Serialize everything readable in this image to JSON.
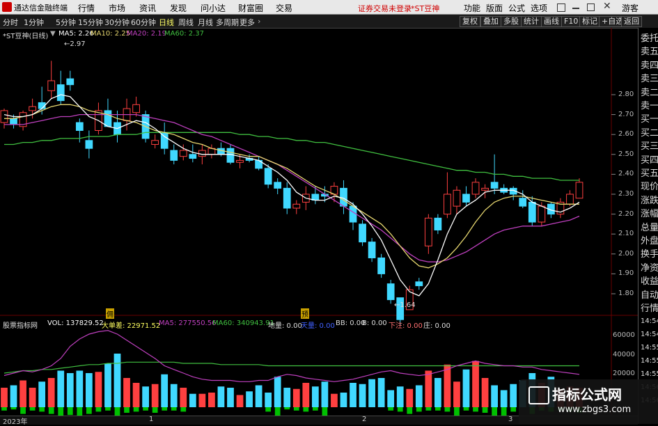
{
  "menubar": {
    "app_title": "通达信金融终端",
    "items": [
      "行情",
      "市场",
      "资讯",
      "发现",
      "问小达",
      "财富圈",
      "交易"
    ],
    "notice": "证券交易未登录",
    "stock": "*ST豆神",
    "right_items": [
      "功能",
      "版面",
      "公式",
      "选项"
    ],
    "guest": "游客"
  },
  "toolbar": {
    "periods": [
      "分时",
      "1分钟",
      "5分钟",
      "15分钟",
      "30分钟",
      "60分钟",
      "日线",
      "周线",
      "月线",
      "多周期",
      "更多"
    ],
    "active_period": "日线",
    "right_buttons": [
      "复权",
      "叠加",
      "多股",
      "统计",
      "画线",
      "F10",
      "标记",
      "+自选",
      "返回"
    ]
  },
  "price_legend": {
    "name": "*ST豆神(日线)",
    "ma5": "MA5: 2.26",
    "ma10": "MA10: 2.25",
    "ma20": "MA20: 2.19",
    "ma60": "MA60: 2.37"
  },
  "price_axis": [
    "2.80",
    "2.70",
    "2.60",
    "2.50",
    "2.40",
    "2.30",
    "2.20",
    "2.10",
    "2.00",
    "1.90",
    "1.80"
  ],
  "annotations": {
    "high": "2.97",
    "low": "1.64",
    "mark1": "佣",
    "mark2": "预"
  },
  "volume_legend": {
    "name": "股票指标网",
    "vol": "VOL: 137829.52",
    "big_diff": "大单差: 22971.52",
    "ma5": "MA5: 277550.56",
    "ma60": "MA60: 340943.91",
    "diliang": "地量: 0.00",
    "tianliang": "天量: 0.00",
    "bb": "BB: 0.00",
    "b": "B: 0.00",
    "xiazhu": "下注: 0.00",
    "zhuang": "庄: 0.00"
  },
  "volume_axis": [
    "60000",
    "40000",
    "20000"
  ],
  "time_axis": [
    "2023年",
    "1",
    "2",
    "3"
  ],
  "right_panel": {
    "labels": [
      "委托",
      "卖五",
      "卖四",
      "卖三",
      "卖二",
      "卖一",
      "买一",
      "买二",
      "买三",
      "买四",
      "买五",
      "现价",
      "涨跌",
      "涨幅",
      "总量",
      "外盘",
      "换手",
      "净资",
      "收益",
      "自动",
      "行情"
    ],
    "times": [
      "14:54",
      "14:54",
      "14:55",
      "14:55",
      "14:55",
      "14:56",
      "14:56"
    ]
  },
  "watermark": {
    "title": "指标公式网",
    "url": "www.zbgs3.com"
  },
  "colors": {
    "up": "#ff4040",
    "down": "#40d8ff",
    "ma5": "#ffffff",
    "ma10": "#e8d870",
    "ma20": "#c040c0",
    "ma60": "#40c040",
    "volume_ma5": "#c040c0",
    "volume_ma60": "#40c040",
    "negative_bar": "#00c000"
  },
  "chart_data": {
    "type": "candlestick",
    "y_range": [
      1.64,
      2.97
    ],
    "candles": [
      {
        "o": 2.66,
        "h": 2.73,
        "l": 2.63,
        "c": 2.72
      },
      {
        "o": 2.68,
        "h": 2.7,
        "l": 2.63,
        "c": 2.65
      },
      {
        "o": 2.64,
        "h": 2.72,
        "l": 2.62,
        "c": 2.71
      },
      {
        "o": 2.72,
        "h": 2.78,
        "l": 2.68,
        "c": 2.74
      },
      {
        "o": 2.76,
        "h": 2.84,
        "l": 2.7,
        "c": 2.73
      },
      {
        "o": 2.82,
        "h": 2.97,
        "l": 2.78,
        "c": 2.87
      },
      {
        "o": 2.85,
        "h": 2.92,
        "l": 2.75,
        "c": 2.77
      },
      {
        "o": 2.88,
        "h": 2.92,
        "l": 2.82,
        "c": 2.85
      },
      {
        "o": 2.66,
        "h": 2.68,
        "l": 2.56,
        "c": 2.62
      },
      {
        "o": 2.57,
        "h": 2.62,
        "l": 2.48,
        "c": 2.53
      },
      {
        "o": 2.62,
        "h": 2.76,
        "l": 2.6,
        "c": 2.72
      },
      {
        "o": 2.72,
        "h": 2.78,
        "l": 2.68,
        "c": 2.64
      },
      {
        "o": 2.66,
        "h": 2.72,
        "l": 2.56,
        "c": 2.6
      },
      {
        "o": 2.67,
        "h": 2.78,
        "l": 2.62,
        "c": 2.73
      },
      {
        "o": 2.71,
        "h": 2.79,
        "l": 2.69,
        "c": 2.75
      },
      {
        "o": 2.7,
        "h": 2.72,
        "l": 2.56,
        "c": 2.58
      },
      {
        "o": 2.55,
        "h": 2.6,
        "l": 2.53,
        "c": 2.57
      },
      {
        "o": 2.61,
        "h": 2.66,
        "l": 2.5,
        "c": 2.53
      },
      {
        "o": 2.52,
        "h": 2.55,
        "l": 2.45,
        "c": 2.47
      },
      {
        "o": 2.49,
        "h": 2.55,
        "l": 2.47,
        "c": 2.52
      },
      {
        "o": 2.5,
        "h": 2.55,
        "l": 2.46,
        "c": 2.48
      },
      {
        "o": 2.49,
        "h": 2.55,
        "l": 2.45,
        "c": 2.52
      },
      {
        "o": 2.5,
        "h": 2.55,
        "l": 2.48,
        "c": 2.53
      },
      {
        "o": 2.53,
        "h": 2.56,
        "l": 2.49,
        "c": 2.5
      },
      {
        "o": 2.53,
        "h": 2.55,
        "l": 2.45,
        "c": 2.46
      },
      {
        "o": 2.46,
        "h": 2.5,
        "l": 2.43,
        "c": 2.47
      },
      {
        "o": 2.48,
        "h": 2.5,
        "l": 2.46,
        "c": 2.47
      },
      {
        "o": 2.47,
        "h": 2.49,
        "l": 2.42,
        "c": 2.43
      },
      {
        "o": 2.43,
        "h": 2.45,
        "l": 2.33,
        "c": 2.35
      },
      {
        "o": 2.36,
        "h": 2.38,
        "l": 2.3,
        "c": 2.33
      },
      {
        "o": 2.33,
        "h": 2.36,
        "l": 2.2,
        "c": 2.23
      },
      {
        "o": 2.23,
        "h": 2.27,
        "l": 2.2,
        "c": 2.25
      },
      {
        "o": 2.26,
        "h": 2.34,
        "l": 2.22,
        "c": 2.3
      },
      {
        "o": 2.3,
        "h": 2.34,
        "l": 2.25,
        "c": 2.27
      },
      {
        "o": 2.3,
        "h": 2.34,
        "l": 2.26,
        "c": 2.29
      },
      {
        "o": 2.3,
        "h": 2.36,
        "l": 2.26,
        "c": 2.34
      },
      {
        "o": 2.33,
        "h": 2.37,
        "l": 2.2,
        "c": 2.24
      },
      {
        "o": 2.24,
        "h": 2.26,
        "l": 2.12,
        "c": 2.16
      },
      {
        "o": 2.15,
        "h": 2.17,
        "l": 2.04,
        "c": 2.06
      },
      {
        "o": 2.06,
        "h": 2.08,
        "l": 1.96,
        "c": 1.98
      },
      {
        "o": 1.98,
        "h": 2.0,
        "l": 1.88,
        "c": 1.9
      },
      {
        "o": 1.85,
        "h": 1.87,
        "l": 1.75,
        "c": 1.77
      },
      {
        "o": 1.78,
        "h": 1.78,
        "l": 1.64,
        "c": 1.67
      },
      {
        "o": 1.72,
        "h": 1.84,
        "l": 1.72,
        "c": 1.82
      },
      {
        "o": 1.86,
        "h": 1.88,
        "l": 1.82,
        "c": 1.84
      },
      {
        "o": 2.04,
        "h": 2.2,
        "l": 2.0,
        "c": 2.18
      },
      {
        "o": 2.18,
        "h": 2.2,
        "l": 2.1,
        "c": 2.12
      },
      {
        "o": 2.2,
        "h": 2.41,
        "l": 2.18,
        "c": 2.3
      },
      {
        "o": 2.24,
        "h": 2.34,
        "l": 2.2,
        "c": 2.32
      },
      {
        "o": 2.3,
        "h": 2.34,
        "l": 2.24,
        "c": 2.26
      },
      {
        "o": 2.3,
        "h": 2.38,
        "l": 2.28,
        "c": 2.36
      },
      {
        "o": 2.32,
        "h": 2.35,
        "l": 2.28,
        "c": 2.33
      },
      {
        "o": 2.36,
        "h": 2.5,
        "l": 2.3,
        "c": 2.33
      },
      {
        "o": 2.33,
        "h": 2.35,
        "l": 2.3,
        "c": 2.31
      },
      {
        "o": 2.33,
        "h": 2.34,
        "l": 2.27,
        "c": 2.3
      },
      {
        "o": 2.28,
        "h": 2.32,
        "l": 2.23,
        "c": 2.24
      },
      {
        "o": 2.26,
        "h": 2.29,
        "l": 2.14,
        "c": 2.16
      },
      {
        "o": 2.16,
        "h": 2.26,
        "l": 2.14,
        "c": 2.24
      },
      {
        "o": 2.25,
        "h": 2.26,
        "l": 2.18,
        "c": 2.2
      },
      {
        "o": 2.2,
        "h": 2.28,
        "l": 2.18,
        "c": 2.26
      },
      {
        "o": 2.25,
        "h": 2.32,
        "l": 2.24,
        "c": 2.3
      },
      {
        "o": 2.28,
        "h": 2.38,
        "l": 2.28,
        "c": 2.36
      }
    ],
    "ma5": [
      2.7,
      2.69,
      2.69,
      2.7,
      2.73,
      2.78,
      2.8,
      2.79,
      2.74,
      2.69,
      2.67,
      2.64,
      2.63,
      2.65,
      2.67,
      2.66,
      2.63,
      2.59,
      2.56,
      2.53,
      2.51,
      2.5,
      2.5,
      2.5,
      2.5,
      2.49,
      2.48,
      2.47,
      2.44,
      2.41,
      2.37,
      2.31,
      2.28,
      2.27,
      2.27,
      2.29,
      2.28,
      2.25,
      2.2,
      2.14,
      2.07,
      1.97,
      1.87,
      1.81,
      1.79,
      1.85,
      1.97,
      2.1,
      2.2,
      2.24,
      2.27,
      2.31,
      2.32,
      2.32,
      2.32,
      2.3,
      2.26,
      2.24,
      2.22,
      2.21,
      2.23,
      2.26
    ],
    "ma10": [
      2.68,
      2.68,
      2.69,
      2.7,
      2.72,
      2.74,
      2.75,
      2.75,
      2.74,
      2.72,
      2.71,
      2.7,
      2.68,
      2.67,
      2.66,
      2.64,
      2.62,
      2.61,
      2.6,
      2.58,
      2.56,
      2.55,
      2.53,
      2.52,
      2.51,
      2.5,
      2.49,
      2.49,
      2.47,
      2.45,
      2.43,
      2.4,
      2.37,
      2.34,
      2.32,
      2.3,
      2.27,
      2.24,
      2.21,
      2.18,
      2.15,
      2.1,
      2.04,
      1.98,
      1.94,
      1.93,
      1.95,
      1.98,
      2.03,
      2.09,
      2.16,
      2.22,
      2.26,
      2.28,
      2.29,
      2.29,
      2.28,
      2.27,
      2.26,
      2.25,
      2.25,
      2.25
    ],
    "ma20": [
      2.65,
      2.65,
      2.65,
      2.66,
      2.67,
      2.68,
      2.69,
      2.69,
      2.7,
      2.7,
      2.7,
      2.7,
      2.7,
      2.7,
      2.7,
      2.69,
      2.68,
      2.67,
      2.66,
      2.64,
      2.62,
      2.6,
      2.59,
      2.57,
      2.55,
      2.53,
      2.51,
      2.49,
      2.47,
      2.45,
      2.42,
      2.39,
      2.36,
      2.33,
      2.3,
      2.27,
      2.24,
      2.21,
      2.18,
      2.15,
      2.12,
      2.08,
      2.04,
      2.0,
      1.97,
      1.96,
      1.96,
      1.97,
      1.99,
      2.01,
      2.04,
      2.07,
      2.1,
      2.12,
      2.13,
      2.14,
      2.14,
      2.14,
      2.15,
      2.16,
      2.17,
      2.19
    ],
    "ma60": [
      2.55,
      2.55,
      2.56,
      2.56,
      2.57,
      2.57,
      2.58,
      2.58,
      2.58,
      2.59,
      2.59,
      2.59,
      2.6,
      2.6,
      2.6,
      2.61,
      2.61,
      2.61,
      2.61,
      2.61,
      2.61,
      2.61,
      2.61,
      2.61,
      2.61,
      2.6,
      2.6,
      2.59,
      2.59,
      2.58,
      2.58,
      2.57,
      2.57,
      2.56,
      2.56,
      2.55,
      2.54,
      2.53,
      2.52,
      2.51,
      2.5,
      2.49,
      2.48,
      2.47,
      2.46,
      2.45,
      2.44,
      2.43,
      2.42,
      2.42,
      2.41,
      2.41,
      2.4,
      2.4,
      2.39,
      2.39,
      2.38,
      2.38,
      2.38,
      2.37,
      2.37,
      2.37
    ],
    "volume": {
      "y_range": [
        0,
        65000
      ],
      "bars": [
        16,
        18,
        22,
        16,
        21,
        24,
        30,
        28,
        30,
        28,
        29,
        36,
        44,
        24,
        20,
        17,
        19,
        27,
        19,
        16,
        11,
        11,
        12,
        17,
        16,
        10,
        13,
        18,
        12,
        25,
        16,
        15,
        20,
        17,
        21,
        11,
        12,
        20,
        19,
        23,
        24,
        14,
        17,
        15,
        18,
        30,
        24,
        35,
        21,
        31,
        38,
        24,
        18,
        14,
        19,
        22,
        28,
        20,
        25,
        15,
        17,
        16
      ],
      "negative_bars": [
        3,
        2,
        6,
        3,
        4,
        6,
        8,
        7,
        9,
        6,
        4,
        3,
        11,
        5,
        4,
        3,
        5,
        3,
        3,
        4,
        0,
        0,
        0,
        0,
        0,
        0,
        0,
        0,
        4,
        10,
        2,
        3,
        4,
        3,
        8,
        0,
        0,
        0,
        0,
        0,
        0,
        3,
        4,
        6,
        4,
        3,
        3,
        4,
        8,
        3,
        4,
        5,
        9,
        10,
        4,
        0,
        6,
        3,
        4,
        3,
        4,
        5
      ],
      "ma5": [
        26,
        28,
        30,
        29,
        31,
        34,
        40,
        50,
        56,
        60,
        62,
        63,
        60,
        55,
        50,
        45,
        40,
        34,
        31,
        28,
        25,
        23,
        22,
        22,
        22,
        21,
        21,
        22,
        22,
        25,
        27,
        26,
        24,
        23,
        22,
        21,
        22,
        23,
        25,
        27,
        29,
        30,
        28,
        27,
        26,
        27,
        29,
        31,
        34,
        36,
        38,
        36,
        35,
        34,
        34,
        33,
        33,
        31,
        30,
        29,
        28,
        27
      ],
      "ma60": [
        28,
        29,
        30,
        30,
        31,
        31,
        32,
        33,
        34,
        35,
        35,
        36,
        36,
        37,
        37,
        37,
        37,
        37,
        37,
        36,
        36,
        36,
        36,
        35,
        35,
        35,
        35,
        35,
        34,
        34,
        34,
        34,
        34,
        34,
        34,
        34,
        34,
        34,
        34,
        34,
        34,
        34,
        34,
        34,
        34,
        34,
        34,
        34,
        34,
        34,
        34,
        34,
        34,
        34,
        34,
        34,
        34,
        34,
        34,
        34,
        34,
        34
      ]
    }
  }
}
